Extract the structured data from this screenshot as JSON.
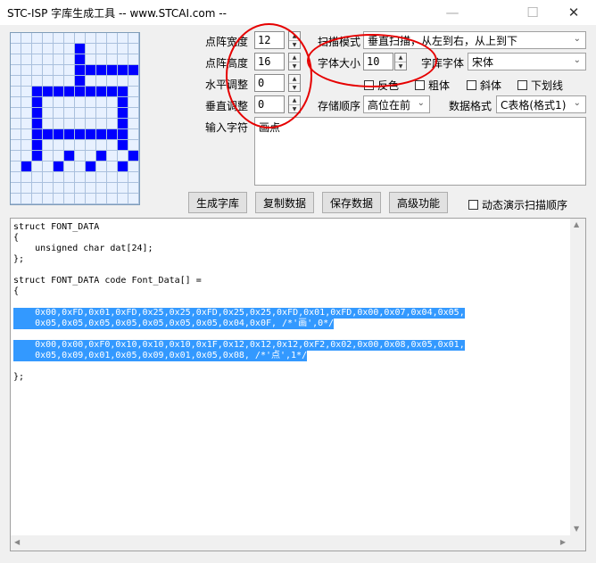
{
  "window": {
    "title": "STC-ISP 字库生成工具 -- www.STCAI.com --",
    "minimize_glyph": "—",
    "maximize_glyph": "☐",
    "close_glyph": "✕"
  },
  "dot_grid": {
    "cols": 12,
    "rows": 16,
    "on_color": "#0000ff",
    "off_color": "#e8f1ff",
    "rows_data": [
      "............",
      "......X.....",
      "......X.....",
      "......XXXXXX",
      "......X.....",
      "..XXXXXXXXX.",
      "..X.......X.",
      "..X.......X.",
      "..X.......X.",
      "..XXXXXXXXX.",
      "..X.......X.",
      "..X..X..X..X",
      ".X..X..X..X.",
      "............",
      "............",
      "............"
    ]
  },
  "fields": {
    "width_label": "点阵宽度",
    "width_value": "12",
    "height_label": "点阵高度",
    "height_value": "16",
    "hadjust_label": "水平调整",
    "hadjust_value": "0",
    "vadjust_label": "垂直调整",
    "vadjust_value": "0",
    "input_label": "输入字符",
    "input_value": "画点",
    "fontsize_label": "字体大小",
    "fontsize_value": "10",
    "scan_label": "扫描模式",
    "scan_value": "垂直扫描，从左到右，从上到下",
    "font_label": "字库字体",
    "font_value": "宋体",
    "order_label": "存储顺序",
    "order_value": "高位在前",
    "format_label": "数据格式",
    "format_value": "C表格(格式1)"
  },
  "checkboxes": {
    "invert": "反色",
    "bold": "粗体",
    "italic": "斜体",
    "underline": "下划线",
    "animate": "动态演示扫描顺序"
  },
  "buttons": {
    "generate": "生成字库",
    "copy": "复制数据",
    "save": "保存数据",
    "advanced": "高级功能"
  },
  "output": {
    "line1": "struct FONT_DATA",
    "line2": "{",
    "line3": "    unsigned char dat[24];",
    "line4": "};",
    "line5": "struct FONT_DATA code Font_Data[] =",
    "line6": "{",
    "line7": "    0x00,0xFD,0x01,0xFD,0x25,0x25,0xFD,0x25,0x25,0xFD,0x01,0xFD,0x00,0x07,0x04,0x05,",
    "line8": "    0x05,0x05,0x05,0x05,0x05,0x05,0x05,0x04,0x0F, /*'画',0*/",
    "line9": "    0x00,0x00,0xF0,0x10,0x10,0x10,0x1F,0x12,0x12,0x12,0xF2,0x02,0x00,0x08,0x05,0x01,",
    "line10": "    0x05,0x09,0x01,0x05,0x09,0x01,0x05,0x08, /*'点',1*/",
    "line11": "};"
  },
  "colors": {
    "annotation_circle": "#e60000",
    "selection": "#3399ff"
  }
}
